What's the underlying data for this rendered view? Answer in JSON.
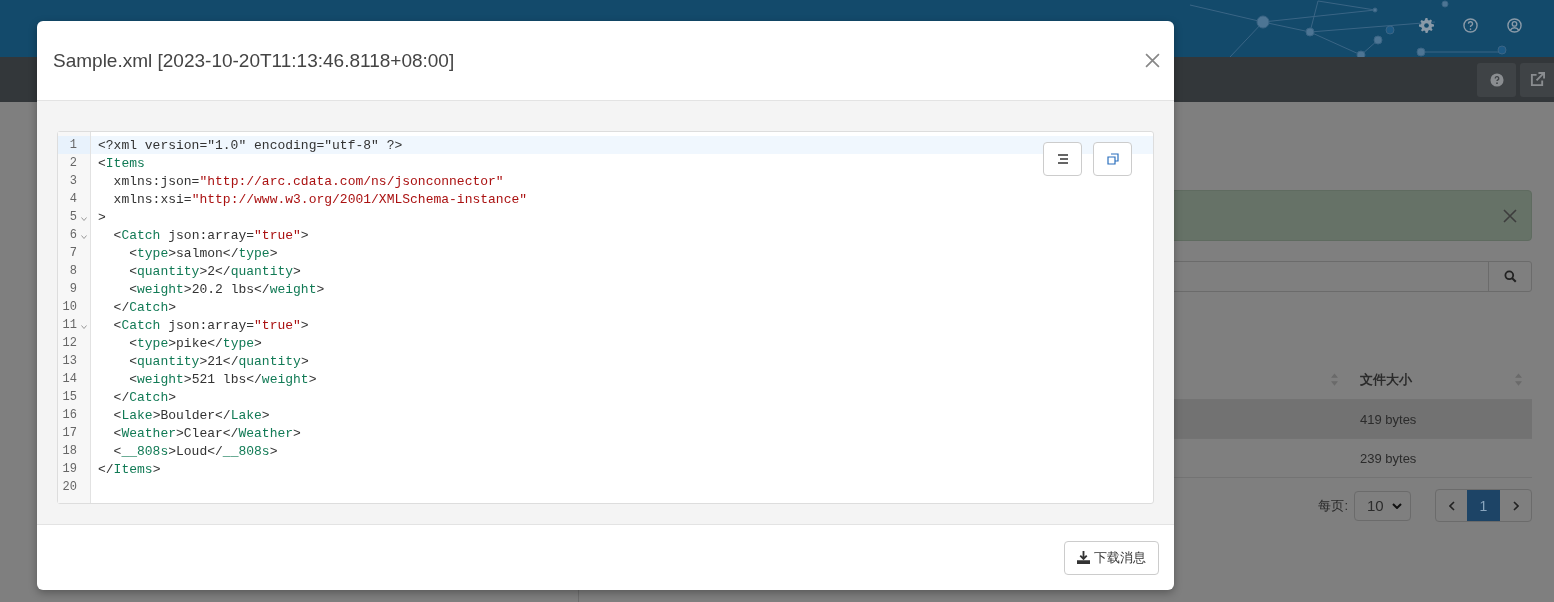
{
  "table": {
    "columns": [
      {
        "label": "文件大小"
      }
    ],
    "rows": [
      {
        "cells": [
          "419 bytes"
        ],
        "selected": true
      },
      {
        "cells": [
          "239 bytes"
        ],
        "selected": false
      }
    ]
  },
  "pagination": {
    "per_page_label": "每页:",
    "per_page": "10",
    "pages": [
      {
        "label": "1",
        "selected": true
      }
    ]
  },
  "modal": {
    "title": "Sample.xml [2023-10-20T11:13:46.8118+08:00]",
    "code_lines": [
      {
        "number": "1",
        "fold": false,
        "active": true,
        "tokens": [
          {
            "kind": "plain",
            "text": "<?xml version=\"1.0\" encoding=\"utf-8\" ?>"
          }
        ]
      },
      {
        "number": "2",
        "fold": false,
        "active": false,
        "tokens": [
          {
            "kind": "plain",
            "text": "<"
          },
          {
            "kind": "tag",
            "text": "Items"
          }
        ]
      },
      {
        "number": "3",
        "fold": false,
        "active": false,
        "tokens": [
          {
            "kind": "plain",
            "text": "  xmlns:json="
          },
          {
            "kind": "string",
            "text": "\"http://arc.cdata.com/ns/jsonconnector\""
          }
        ]
      },
      {
        "number": "4",
        "fold": false,
        "active": false,
        "tokens": [
          {
            "kind": "plain",
            "text": "  xmlns:xsi="
          },
          {
            "kind": "string",
            "text": "\"http://www.w3.org/2001/XMLSchema-instance\""
          }
        ]
      },
      {
        "number": "5",
        "fold": true,
        "active": false,
        "tokens": [
          {
            "kind": "plain",
            "text": ">"
          }
        ]
      },
      {
        "number": "6",
        "fold": true,
        "active": false,
        "tokens": [
          {
            "kind": "plain",
            "text": "  <"
          },
          {
            "kind": "tag",
            "text": "Catch"
          },
          {
            "kind": "plain",
            "text": " json:array="
          },
          {
            "kind": "string",
            "text": "\"true\""
          },
          {
            "kind": "plain",
            "text": ">"
          }
        ]
      },
      {
        "number": "7",
        "fold": false,
        "active": false,
        "tokens": [
          {
            "kind": "plain",
            "text": "    <"
          },
          {
            "kind": "tag",
            "text": "type"
          },
          {
            "kind": "plain",
            "text": ">salmon</"
          },
          {
            "kind": "tag",
            "text": "type"
          },
          {
            "kind": "plain",
            "text": ">"
          }
        ]
      },
      {
        "number": "8",
        "fold": false,
        "active": false,
        "tokens": [
          {
            "kind": "plain",
            "text": "    <"
          },
          {
            "kind": "tag",
            "text": "quantity"
          },
          {
            "kind": "plain",
            "text": ">2</"
          },
          {
            "kind": "tag",
            "text": "quantity"
          },
          {
            "kind": "plain",
            "text": ">"
          }
        ]
      },
      {
        "number": "9",
        "fold": false,
        "active": false,
        "tokens": [
          {
            "kind": "plain",
            "text": "    <"
          },
          {
            "kind": "tag",
            "text": "weight"
          },
          {
            "kind": "plain",
            "text": ">20.2 lbs</"
          },
          {
            "kind": "tag",
            "text": "weight"
          },
          {
            "kind": "plain",
            "text": ">"
          }
        ]
      },
      {
        "number": "10",
        "fold": false,
        "active": false,
        "tokens": [
          {
            "kind": "plain",
            "text": "  </"
          },
          {
            "kind": "tag",
            "text": "Catch"
          },
          {
            "kind": "plain",
            "text": ">"
          }
        ]
      },
      {
        "number": "11",
        "fold": true,
        "active": false,
        "tokens": [
          {
            "kind": "plain",
            "text": "  <"
          },
          {
            "kind": "tag",
            "text": "Catch"
          },
          {
            "kind": "plain",
            "text": " json:array="
          },
          {
            "kind": "string",
            "text": "\"true\""
          },
          {
            "kind": "plain",
            "text": ">"
          }
        ]
      },
      {
        "number": "12",
        "fold": false,
        "active": false,
        "tokens": [
          {
            "kind": "plain",
            "text": "    <"
          },
          {
            "kind": "tag",
            "text": "type"
          },
          {
            "kind": "plain",
            "text": ">pike</"
          },
          {
            "kind": "tag",
            "text": "type"
          },
          {
            "kind": "plain",
            "text": ">"
          }
        ]
      },
      {
        "number": "13",
        "fold": false,
        "active": false,
        "tokens": [
          {
            "kind": "plain",
            "text": "    <"
          },
          {
            "kind": "tag",
            "text": "quantity"
          },
          {
            "kind": "plain",
            "text": ">21</"
          },
          {
            "kind": "tag",
            "text": "quantity"
          },
          {
            "kind": "plain",
            "text": ">"
          }
        ]
      },
      {
        "number": "14",
        "fold": false,
        "active": false,
        "tokens": [
          {
            "kind": "plain",
            "text": "    <"
          },
          {
            "kind": "tag",
            "text": "weight"
          },
          {
            "kind": "plain",
            "text": ">521 lbs</"
          },
          {
            "kind": "tag",
            "text": "weight"
          },
          {
            "kind": "plain",
            "text": ">"
          }
        ]
      },
      {
        "number": "15",
        "fold": false,
        "active": false,
        "tokens": [
          {
            "kind": "plain",
            "text": "  </"
          },
          {
            "kind": "tag",
            "text": "Catch"
          },
          {
            "kind": "plain",
            "text": ">"
          }
        ]
      },
      {
        "number": "16",
        "fold": false,
        "active": false,
        "tokens": [
          {
            "kind": "plain",
            "text": "  <"
          },
          {
            "kind": "tag",
            "text": "Lake"
          },
          {
            "kind": "plain",
            "text": ">Boulder</"
          },
          {
            "kind": "tag",
            "text": "Lake"
          },
          {
            "kind": "plain",
            "text": ">"
          }
        ]
      },
      {
        "number": "17",
        "fold": false,
        "active": false,
        "tokens": [
          {
            "kind": "plain",
            "text": "  <"
          },
          {
            "kind": "tag",
            "text": "Weather"
          },
          {
            "kind": "plain",
            "text": ">Clear</"
          },
          {
            "kind": "tag",
            "text": "Weather"
          },
          {
            "kind": "plain",
            "text": ">"
          }
        ]
      },
      {
        "number": "18",
        "fold": false,
        "active": false,
        "tokens": [
          {
            "kind": "plain",
            "text": "  <"
          },
          {
            "kind": "tag",
            "text": "__808s"
          },
          {
            "kind": "plain",
            "text": ">Loud</"
          },
          {
            "kind": "tag",
            "text": "__808s"
          },
          {
            "kind": "plain",
            "text": ">"
          }
        ]
      },
      {
        "number": "19",
        "fold": false,
        "active": false,
        "tokens": [
          {
            "kind": "plain",
            "text": "</"
          },
          {
            "kind": "tag",
            "text": "Items"
          },
          {
            "kind": "plain",
            "text": ">"
          }
        ]
      },
      {
        "number": "20",
        "fold": false,
        "active": false
      }
    ],
    "download_button": "下载消息"
  }
}
